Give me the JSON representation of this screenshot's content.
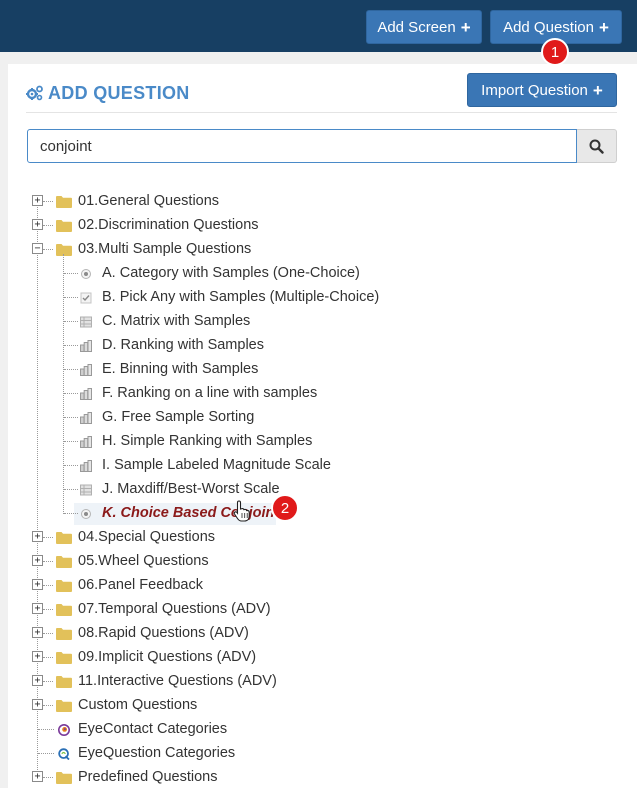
{
  "header": {
    "add_screen_label": "Add Screen",
    "add_question_label": "Add Question",
    "plus_symbol": "+"
  },
  "markers": {
    "first": "1",
    "second": "2"
  },
  "panel": {
    "title": "ADD QUESTION",
    "import_label": "Import Question"
  },
  "search": {
    "value": "conjoint",
    "placeholder": ""
  },
  "tree": {
    "folders_before": [
      {
        "label": "01.General Questions",
        "toggle": "+"
      },
      {
        "label": "02.Discrimination Questions",
        "toggle": "+"
      },
      {
        "label": "03.Multi Sample Questions",
        "toggle": "−"
      }
    ],
    "children": [
      {
        "label": "A. Category with Samples (One-Choice)",
        "icon": "radio-icon"
      },
      {
        "label": "B. Pick Any with Samples (Multiple-Choice)",
        "icon": "checkbox-icon"
      },
      {
        "label": "C. Matrix with Samples",
        "icon": "matrix-icon"
      },
      {
        "label": "D. Ranking with Samples",
        "icon": "ranking-icon"
      },
      {
        "label": "E. Binning with Samples",
        "icon": "ranking-icon"
      },
      {
        "label": "F. Ranking on a line with samples",
        "icon": "ranking-icon"
      },
      {
        "label": "G. Free Sample Sorting",
        "icon": "ranking-icon"
      },
      {
        "label": "H. Simple Ranking with Samples",
        "icon": "ranking-icon"
      },
      {
        "label": "I. Sample Labeled Magnitude Scale",
        "icon": "ranking-icon"
      },
      {
        "label": "J. Maxdiff/Best-Worst Scale",
        "icon": "matrix-icon"
      },
      {
        "label": "K. Choice Based Conjoint",
        "icon": "radio-icon",
        "selected": true
      }
    ],
    "folders_after": [
      {
        "label": "04.Special Questions",
        "toggle": "+"
      },
      {
        "label": "05.Wheel Questions",
        "toggle": "+"
      },
      {
        "label": "06.Panel Feedback",
        "toggle": "+"
      },
      {
        "label": "07.Temporal Questions (ADV)",
        "toggle": "+"
      },
      {
        "label": "08.Rapid Questions (ADV)",
        "toggle": "+"
      },
      {
        "label": "09.Implicit Questions (ADV)",
        "toggle": "+"
      },
      {
        "label": "11.Interactive Questions (ADV)",
        "toggle": "+"
      },
      {
        "label": "Custom Questions",
        "toggle": "+"
      }
    ],
    "category_items": [
      {
        "label": "EyeContact Categories",
        "icon": "eyecontact-logo-icon"
      },
      {
        "label": "EyeQuestion Categories",
        "icon": "eyequestion-logo-icon"
      }
    ],
    "last_folder": {
      "label": "Predefined Questions",
      "toggle": "+"
    }
  },
  "colors": {
    "topbar": "#173f63",
    "button": "#3a76b5",
    "title": "#4a8ac8",
    "selected_text": "#8b1a1a",
    "marker": "#e01a1a",
    "folder": "#e2c15a"
  }
}
